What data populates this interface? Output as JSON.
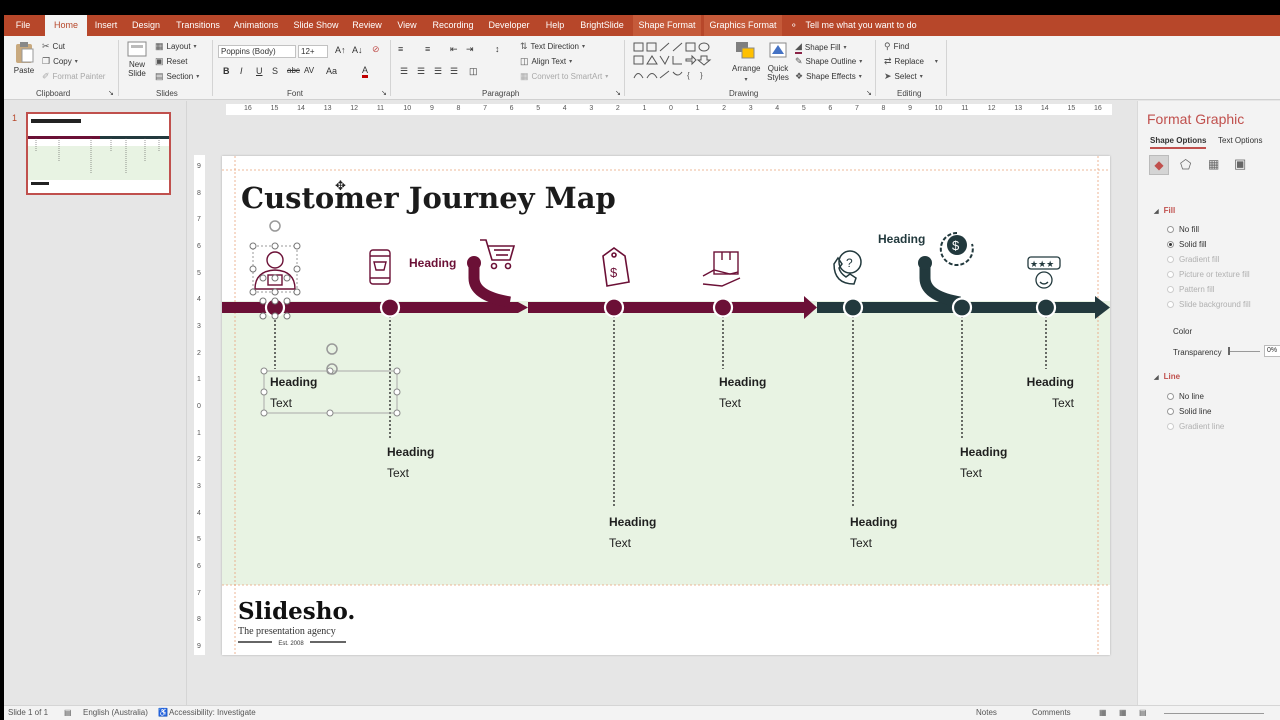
{
  "menubar": {
    "tabs": [
      "File",
      "Home",
      "Insert",
      "Design",
      "Transitions",
      "Animations",
      "Slide Show",
      "Review",
      "View",
      "Recording",
      "Developer",
      "Help",
      "BrightSlide",
      "Shape Format",
      "Graphics Format"
    ],
    "tell_me": "Tell me what you want to do"
  },
  "ribbon": {
    "clipboard": {
      "paste": "Paste",
      "cut": "Cut",
      "copy": "Copy",
      "format_painter": "Format Painter",
      "label": "Clipboard"
    },
    "slides": {
      "new_slide_1": "New",
      "new_slide_2": "Slide",
      "layout": "Layout",
      "reset": "Reset",
      "section": "Section",
      "label": "Slides"
    },
    "font": {
      "family": "Poppins (Body)",
      "size": "12+",
      "label": "Font"
    },
    "paragraph": {
      "text_direction": "Text Direction",
      "align_text": "Align Text",
      "convert_smartart": "Convert to SmartArt",
      "label": "Paragraph"
    },
    "drawing": {
      "arrange": "Arrange",
      "quick_1": "Quick",
      "quick_2": "Styles",
      "shape_fill": "Shape Fill",
      "shape_outline": "Shape Outline",
      "shape_effects": "Shape Effects",
      "label": "Drawing"
    },
    "editing": {
      "find": "Find",
      "replace": "Replace",
      "select": "Select",
      "label": "Editing"
    }
  },
  "thumbnail": {
    "number": "1"
  },
  "ruler": {
    "h": [
      "16",
      "15",
      "14",
      "13",
      "12",
      "11",
      "10",
      "9",
      "8",
      "7",
      "6",
      "5",
      "4",
      "3",
      "2",
      "1",
      "0",
      "1",
      "2",
      "3",
      "4",
      "5",
      "6",
      "7",
      "8",
      "9",
      "10",
      "11",
      "12",
      "13",
      "14",
      "15",
      "16"
    ],
    "v": [
      "9",
      "8",
      "7",
      "6",
      "5",
      "4",
      "3",
      "2",
      "1",
      "0",
      "1",
      "2",
      "3",
      "4",
      "5",
      "6",
      "7",
      "8",
      "9"
    ]
  },
  "slide": {
    "title": "Customer Journey Map",
    "mid_headings": {
      "a": "Heading",
      "b": "Heading"
    },
    "steps": [
      {
        "heading": "Heading",
        "text": "Text"
      },
      {
        "heading": "Heading",
        "text": "Text"
      },
      {
        "heading": "Heading",
        "text": "Text"
      },
      {
        "heading": "Heading",
        "text": "Text"
      },
      {
        "heading": "Heading",
        "text": "Text"
      },
      {
        "heading": "Heading",
        "text": "Text"
      },
      {
        "heading": "Heading",
        "text": "Text"
      }
    ],
    "brand": {
      "name": "Slidesho.",
      "tagline": "The presentation agency",
      "est": "Est. 2008"
    },
    "colors": {
      "maroon": "#6b1036",
      "slate": "#22393d",
      "band": "#e8f3e3"
    }
  },
  "format_pane": {
    "title": "Format Graphic",
    "tab_shape": "Shape Options",
    "tab_text": "Text Options",
    "fill_section": "Fill",
    "fill_options": [
      "No fill",
      "Solid fill",
      "Gradient fill",
      "Picture or texture fill",
      "Pattern fill",
      "Slide background fill"
    ],
    "color_label": "Color",
    "transparency_label": "Transparency",
    "transparency_value": "0%",
    "line_section": "Line",
    "line_options": [
      "No line",
      "Solid line",
      "Gradient line"
    ]
  },
  "status": {
    "slide": "Slide 1 of 1",
    "language": "English (Australia)",
    "accessibility": "Accessibility: Investigate",
    "notes": "Notes",
    "comments": "Comments"
  }
}
